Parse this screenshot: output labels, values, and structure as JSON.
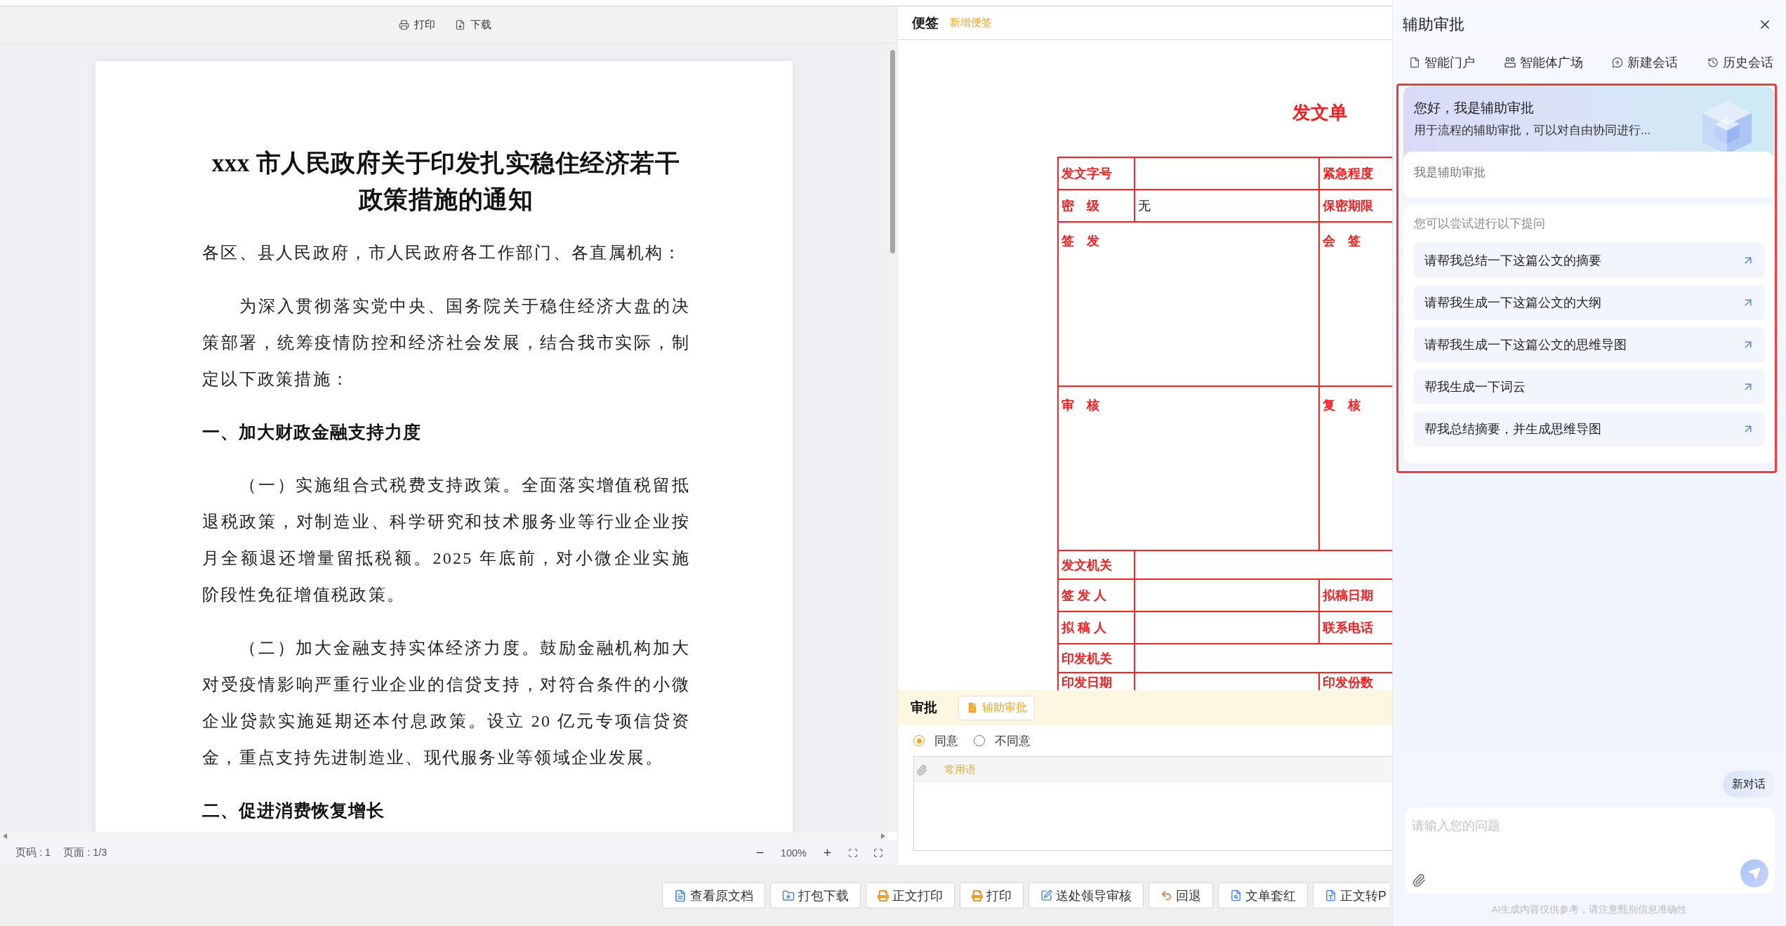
{
  "doc_viewer": {
    "toolbar": [
      {
        "kind": "print",
        "label": "打印"
      },
      {
        "kind": "download",
        "label": "下载"
      }
    ],
    "document": {
      "title": "xxx 市人民政府关于印发扎实稳住经济若干政策措施的通知",
      "blocks": [
        {
          "kind": "salutation",
          "text": "各区、县人民政府，市人民政府各工作部门、各直属机构："
        },
        {
          "kind": "paragraph",
          "text": "为深入贯彻落实党中央、国务院关于稳住经济大盘的决策部署，统筹疫情防控和经济社会发展，结合我市实际，制定以下政策措施："
        },
        {
          "kind": "heading",
          "text": "一、加大财政金融支持力度"
        },
        {
          "kind": "paragraph",
          "text": "（一）实施组合式税费支持政策。全面落实增值税留抵退税政策，对制造业、科学研究和技术服务业等行业企业按月全额退还增量留抵税额。2025 年底前，对小微企业实施阶段性免征增值税政策。"
        },
        {
          "kind": "paragraph",
          "text": "（二）加大金融支持实体经济力度。鼓励金融机构加大对受疫情影响严重行业企业的信贷支持，对符合条件的小微企业贷款实施延期还本付息政策。设立 20 亿元专项信贷资金，重点支持先进制造业、现代服务业等领域企业发展。"
        },
        {
          "kind": "heading",
          "text": "二、促进消费恢复增长"
        }
      ]
    },
    "status_bar": {
      "page": "页码 : 1",
      "pages": "页面 : 1/3",
      "zoom": "100%"
    }
  },
  "notes": {
    "title": "便签",
    "action": "新增便签"
  },
  "form": {
    "title": "发文单",
    "rows": [
      {
        "kind": "pair",
        "label": "发文字号",
        "label_2": "紧急程度"
      },
      {
        "kind": "pair",
        "label": "密　级",
        "value": "无",
        "label_2": "保密期限"
      },
      {
        "kind": "tall",
        "label": "签　发",
        "label_2": "会　签"
      },
      {
        "kind": "tall",
        "label": "审　核",
        "label_2": "复　核"
      },
      {
        "kind": "wide",
        "label": "发文机关"
      },
      {
        "kind": "pair",
        "label": "签 发 人",
        "label_2": "拟稿日期"
      },
      {
        "kind": "pair",
        "label": "拟 稿 人",
        "label_2": "联系电话"
      },
      {
        "kind": "wide",
        "label": "印发机关"
      },
      {
        "kind": "pair",
        "label": "印发日期",
        "label_2": "印发份数"
      }
    ]
  },
  "approval": {
    "title": "审批",
    "assist_button": "辅助审批",
    "options": [
      {
        "label": "同意",
        "selected": true
      },
      {
        "label": "不同意",
        "selected": false
      }
    ],
    "comment": {
      "phrases_label": "常用语"
    }
  },
  "actions": [
    {
      "kind": "document",
      "label": "查看原文档"
    },
    {
      "kind": "download",
      "label": "打包下载"
    },
    {
      "kind": "printer",
      "label": "正文打印"
    },
    {
      "kind": "printer",
      "label": "打印"
    },
    {
      "kind": "edit",
      "label": "送处领导审核"
    },
    {
      "kind": "return",
      "label": "回退"
    },
    {
      "kind": "search",
      "label": "文单套红"
    },
    {
      "kind": "pdf",
      "label": "正文转P"
    }
  ],
  "assistant": {
    "title": "辅助审批",
    "nav": [
      {
        "kind": "portal",
        "label": "智能门户"
      },
      {
        "kind": "plaza",
        "label": "智能体广场"
      },
      {
        "kind": "chat",
        "label": "新建会话"
      },
      {
        "kind": "history",
        "label": "历史会话"
      }
    ],
    "welcome": {
      "highlighted": true,
      "greeting": {
        "title": "您好，我是辅助审批",
        "subtitle": "用于流程的辅助审批，可以对自由协同进行...",
        "intro": "我是辅助审批"
      },
      "suggestions": {
        "heading": "您可以尝试进行以下提问",
        "items": [
          "请帮我总结一下这篇公文的摘要",
          "请帮我生成一下这篇公文的大纲",
          "请帮我生成一下这篇公文的思维导图",
          "帮我生成一下词云",
          "帮我总结摘要，并生成思维导图"
        ]
      }
    },
    "new_chat": "新对话",
    "input": {
      "placeholder": "请输入您的问题"
    },
    "disclaimer": "AI生成内容仅供参考，请注意甄别信息准确性"
  }
}
